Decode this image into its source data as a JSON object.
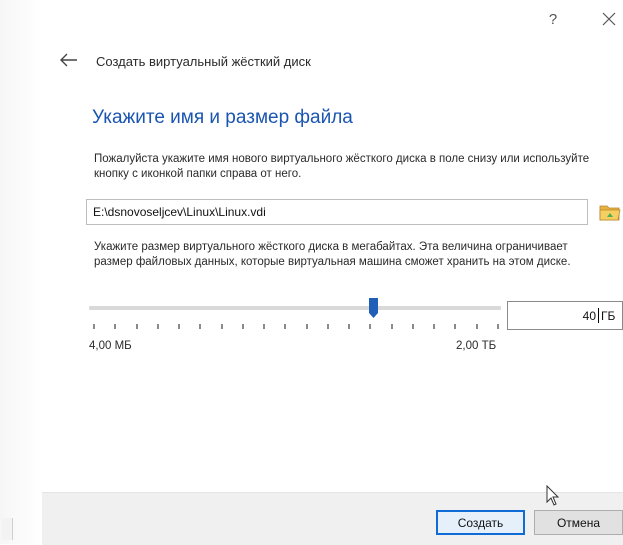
{
  "window": {
    "help_label": "?",
    "close_icon": "close-icon"
  },
  "wizard": {
    "back_icon": "arrow-left-icon",
    "title": "Создать виртуальный жёсткий диск"
  },
  "page": {
    "heading": "Укажите имя и размер файла",
    "file_description": "Пожалуйста укажите имя нового виртуального жёсткого диска в поле снизу или используйте кнопку с иконкой папки справа от него.",
    "file_path": "E:\\dsnovoseljcev\\Linux\\Linux.vdi",
    "folder_icon": "folder-icon",
    "size_description": "Укажите размер виртуального жёсткого диска в мегабайтах. Эта величина ограничивает размер файловых данных, которые виртуальная машина сможет хранить на этом диске.",
    "slider": {
      "min_label": "4,00 МБ",
      "max_label": "2,00 ТБ",
      "position_fraction": 0.69,
      "tick_count": 20
    },
    "size_value": "40",
    "size_unit": "ГБ"
  },
  "footer": {
    "create_label": "Создать",
    "cancel_label": "Отмена"
  },
  "colors": {
    "heading": "#1a55b0",
    "accent": "#0f6bd6",
    "slider_handle": "#1f5fb8",
    "footer_bg": "#f0f0f0"
  }
}
